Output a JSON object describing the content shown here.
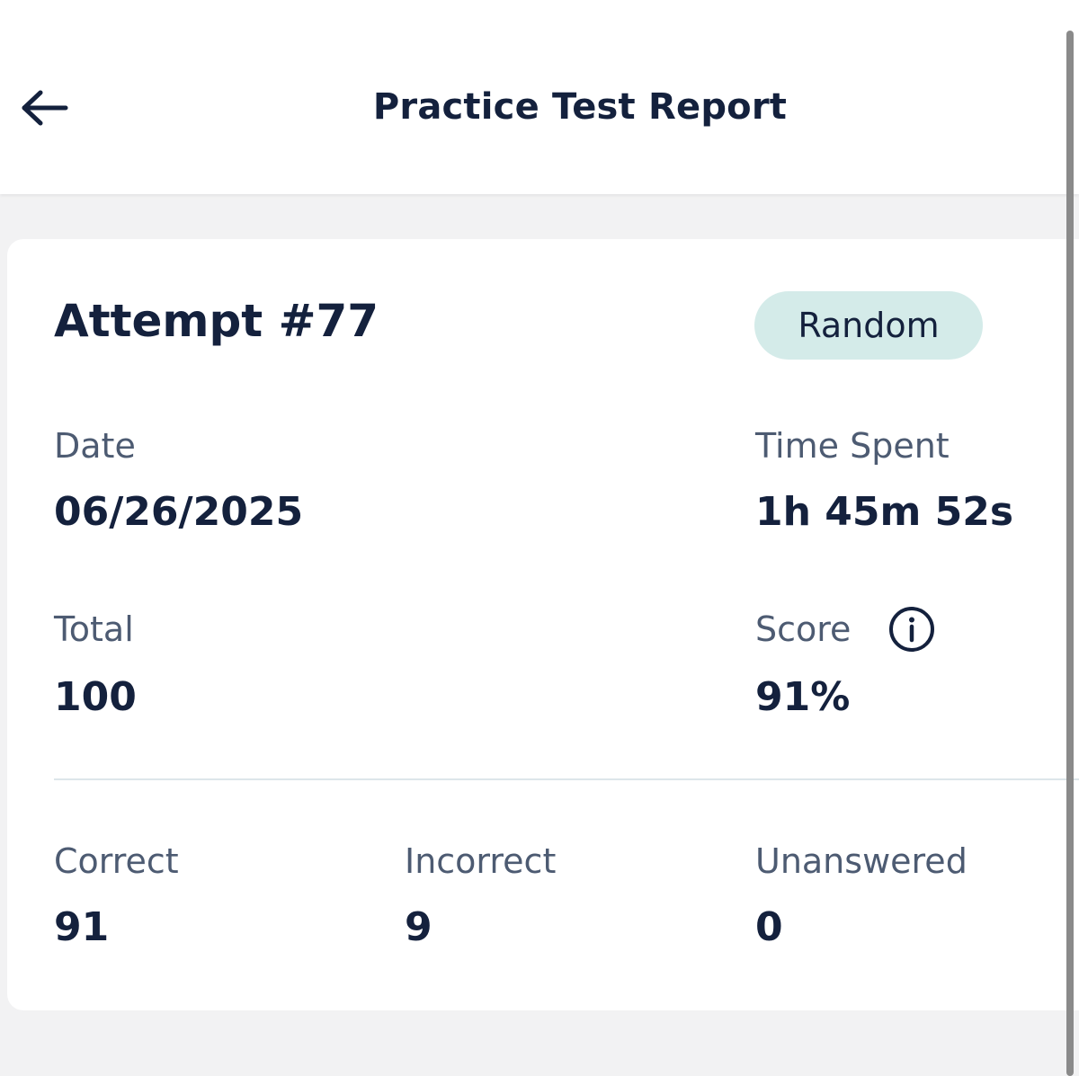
{
  "header": {
    "back_icon": "arrow-left-icon",
    "title": "Practice Test Report"
  },
  "report": {
    "attempt_title": "Attempt #77",
    "mode_badge": "Random",
    "date_label": "Date",
    "date_value": "06/26/2025",
    "time_label": "Time Spent",
    "time_value": "1h 45m 52s",
    "total_label": "Total",
    "total_value": "100",
    "score_label": "Score",
    "score_info_icon": "info-icon",
    "score_value": "91%",
    "correct_label": "Correct",
    "correct_value": "91",
    "incorrect_label": "Incorrect",
    "incorrect_value": "9",
    "unanswered_label": "Unanswered",
    "unanswered_value": "0"
  },
  "colors": {
    "text_primary": "#14213d",
    "text_secondary": "#4d5b72",
    "badge_background": "#d4ebe9",
    "page_background": "#f2f2f3"
  }
}
